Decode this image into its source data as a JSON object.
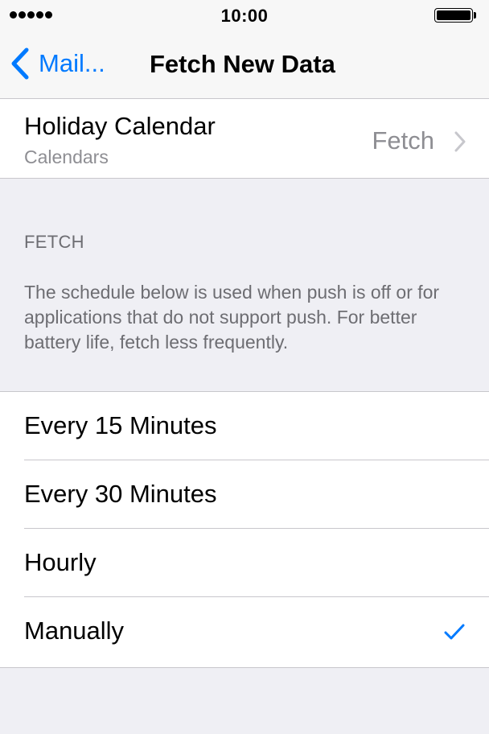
{
  "status_bar": {
    "time": "10:00"
  },
  "nav": {
    "back_label": "Mail...",
    "title": "Fetch New Data"
  },
  "account": {
    "title": "Holiday Calendar",
    "subtitle": "Calendars",
    "value": "Fetch"
  },
  "fetch_section": {
    "header": "FETCH",
    "description": "The schedule below is used when push is off or for applications that do not support push. For better battery life, fetch less frequently."
  },
  "options": [
    {
      "label": "Every 15 Minutes",
      "selected": false
    },
    {
      "label": "Every 30 Minutes",
      "selected": false
    },
    {
      "label": "Hourly",
      "selected": false
    },
    {
      "label": "Manually",
      "selected": true
    }
  ],
  "colors": {
    "accent": "#007aff",
    "background": "#efeff4",
    "secondary_text": "#8e8e93"
  }
}
